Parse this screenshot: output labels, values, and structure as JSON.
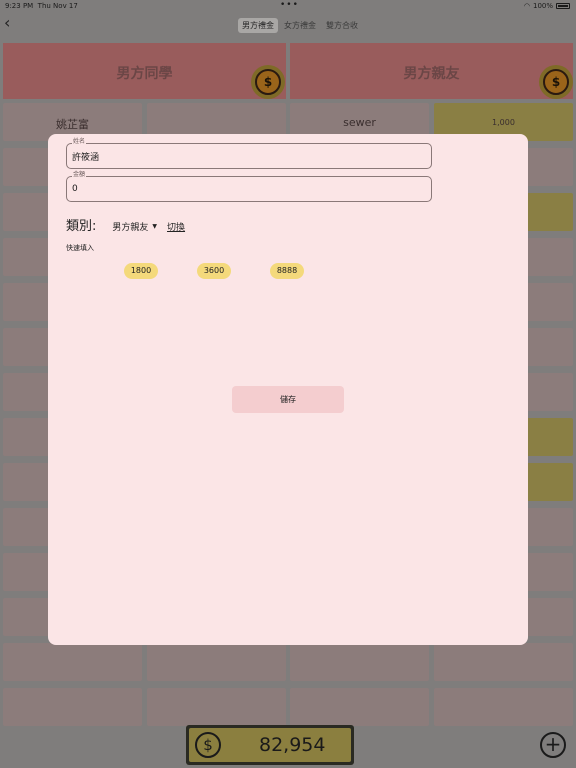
{
  "status_bar": {
    "time": "9:23 PM",
    "date": "Thu Nov 17",
    "dots": "•••",
    "battery": "100%",
    "wifi_icon": "wifi-icon",
    "battery_icon": "battery-icon"
  },
  "nav": {
    "back_icon": "‹",
    "tabs": [
      "男方禮金",
      "女方禮金",
      "雙方合收"
    ],
    "active_tab": 0
  },
  "categories": [
    {
      "label": "男方同學",
      "coin": "$"
    },
    {
      "label": "男方親友",
      "coin": "$"
    }
  ],
  "grid": {
    "row0": [
      "姚芷富",
      "",
      "sewer",
      "1,000"
    ]
  },
  "form": {
    "name_label": "姓名",
    "name_value": "許筱涵",
    "amount_label": "金額",
    "amount_value": "0",
    "category_label": "類別:",
    "category_selected": "男方親友",
    "switch_label": "切換",
    "quick_fill_label": "快速填入",
    "quick_amounts": [
      "1800",
      "3600",
      "8888"
    ],
    "save_label": "儲存"
  },
  "footer": {
    "coin": "$",
    "total": "82,954",
    "add_icon": "+"
  },
  "colors": {
    "modal_bg": "#fbe5e6",
    "chip": "#f4d97b",
    "header": "#995c5c",
    "gold": "#8b7f3f"
  }
}
